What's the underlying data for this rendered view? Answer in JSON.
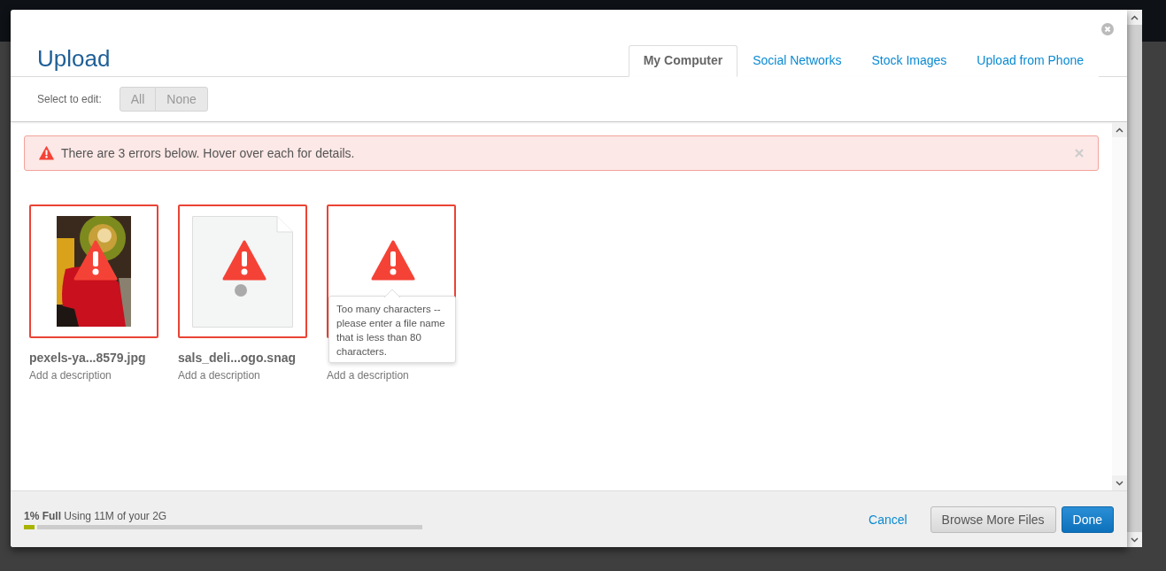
{
  "dialog": {
    "title": "Upload"
  },
  "tabs": [
    {
      "label": "My Computer",
      "selected": true
    },
    {
      "label": "Social Networks",
      "selected": false
    },
    {
      "label": "Stock Images",
      "selected": false
    },
    {
      "label": "Upload from Phone",
      "selected": false
    }
  ],
  "select_bar": {
    "label": "Select to edit:",
    "buttons": [
      "All",
      "None"
    ]
  },
  "alert": {
    "text": "There are 3 errors below. Hover over each for details."
  },
  "files": [
    {
      "error": true,
      "name": "pexels-ya...8579.jpg",
      "description": "Add a description"
    },
    {
      "kind": "document",
      "error": true,
      "name": "sals_deli...ogo.snag",
      "description": "Add a description"
    },
    {
      "kind": "blank",
      "error": true,
      "tooltip": "Too many characters -- please enter a file name that is less than 80 characters.",
      "description": "Add a description"
    }
  ],
  "storage": {
    "text": "**1% Full** Using 11M of your 2G",
    "level": 0.027
  },
  "footer": {
    "cancel": "Cancel",
    "browse": "Browse More Files",
    "done": "Done"
  }
}
